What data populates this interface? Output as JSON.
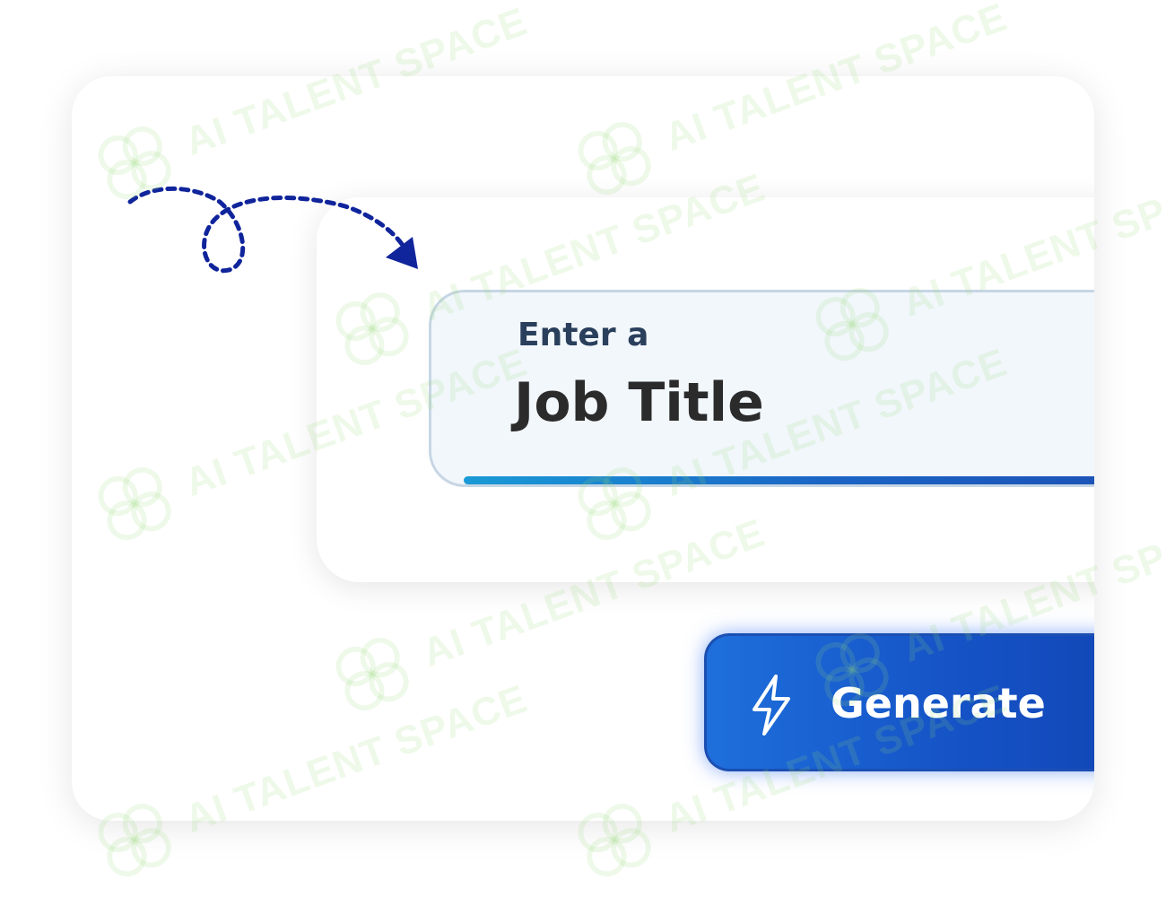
{
  "form": {
    "caption": "Enter a",
    "value": "Job Title"
  },
  "generate": {
    "label": "Generate",
    "icon": "lightning-bolt-icon"
  },
  "watermark": {
    "text": "AI TALENT SPACE"
  },
  "colors": {
    "accent_blue": "#1553c6",
    "arrow_navy": "#10249b",
    "input_bg": "#f2f7fc",
    "watermark_green": "#96dc78"
  }
}
